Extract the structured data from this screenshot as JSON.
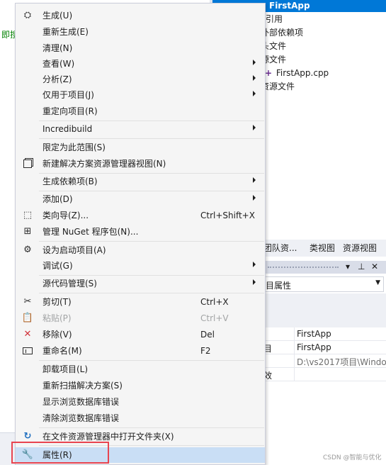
{
  "background": {
    "editor_code_fragment": "即搜",
    "solution_explorer": [
      {
        "text": "FirstApp",
        "selected": true
      },
      {
        "text": "引用"
      },
      {
        "text": "外部依赖项"
      },
      {
        "text": "头文件"
      },
      {
        "text": "源文件"
      },
      {
        "text": "FirstApp.cpp"
      },
      {
        "text": "资源文件"
      }
    ],
    "tabs": [
      "团队资...",
      "类视图",
      "资源视图"
    ],
    "properties_panel": {
      "pin_icon": "pin-icon",
      "close_label": "✕",
      "combo_value": "目属性",
      "rows": [
        {
          "name_fragment": "",
          "value": "FirstApp"
        },
        {
          "name_fragment": "目",
          "value": "FirstApp"
        },
        {
          "name_fragment": "",
          "value": "D:\\vs2017项目\\Windo"
        },
        {
          "name_fragment": "效",
          "value": ""
        }
      ]
    },
    "watermark": "CSDN @智能与优化"
  },
  "context_menu": {
    "items": [
      {
        "label": "生成(U)",
        "icon": "build-icon"
      },
      {
        "label": "重新生成(E)"
      },
      {
        "label": "清理(N)"
      },
      {
        "label": "查看(W)",
        "submenu": true
      },
      {
        "label": "分析(Z)",
        "submenu": true
      },
      {
        "label": "仅用于项目(J)",
        "submenu": true
      },
      {
        "label": "重定向项目(R)"
      },
      {
        "label": "Incredibuild",
        "submenu": true
      },
      {
        "label": "限定为此范围(S)"
      },
      {
        "label": "新建解决方案资源管理器视图(N)",
        "icon": "new-view-icon"
      },
      {
        "label": "生成依赖项(B)",
        "submenu": true
      },
      {
        "label": "添加(D)",
        "submenu": true
      },
      {
        "label": "类向导(Z)...",
        "shortcut": "Ctrl+Shift+X",
        "icon": "class-wizard-icon"
      },
      {
        "label": "管理 NuGet 程序包(N)...",
        "icon": "nuget-icon"
      },
      {
        "label": "设为启动项目(A)",
        "icon": "gear-icon"
      },
      {
        "label": "调试(G)",
        "submenu": true
      },
      {
        "label": "源代码管理(S)",
        "submenu": true
      },
      {
        "label": "剪切(T)",
        "shortcut": "Ctrl+X",
        "icon": "scissors-icon"
      },
      {
        "label": "粘贴(P)",
        "shortcut": "Ctrl+V",
        "icon": "paste-icon",
        "disabled": true
      },
      {
        "label": "移除(V)",
        "shortcut": "Del",
        "icon": "remove-icon"
      },
      {
        "label": "重命名(M)",
        "shortcut": "F2",
        "icon": "rename-icon"
      },
      {
        "label": "卸载项目(L)"
      },
      {
        "label": "重新扫描解决方案(S)"
      },
      {
        "label": "显示浏览数据库错误"
      },
      {
        "label": "清除浏览数据库错误"
      },
      {
        "label": "在文件资源管理器中打开文件夹(X)",
        "icon": "open-folder-icon"
      },
      {
        "label": "属性(R)",
        "icon": "wrench-icon",
        "highlighted": true
      }
    ]
  },
  "colors": {
    "menu_background": "#f5f5f5",
    "hover_highlight": "#c9def5",
    "annotation_box": "#e8444f",
    "selection_blue": "#0078d7"
  }
}
